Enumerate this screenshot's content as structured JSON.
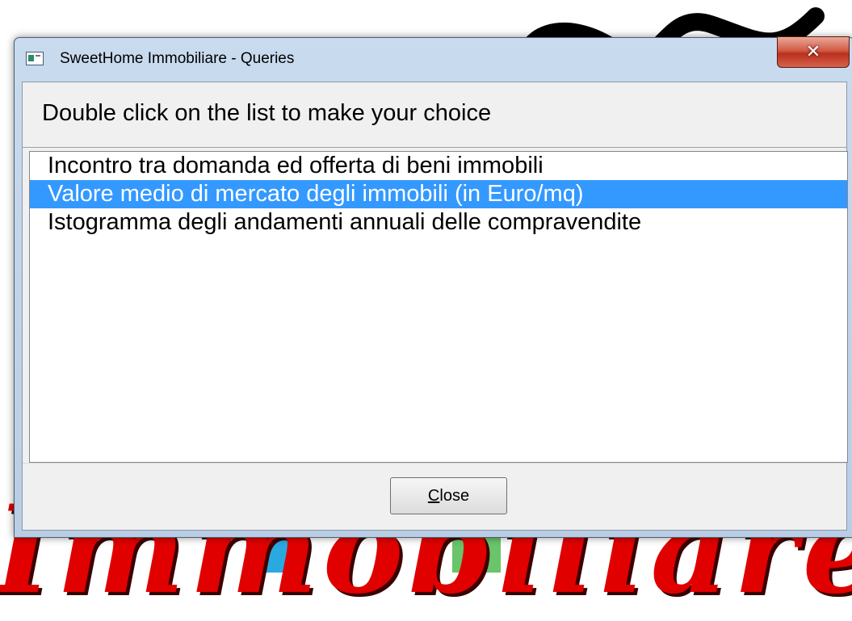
{
  "window": {
    "title": "SweetHome Immobiliare - Queries",
    "close_glyph": "✕"
  },
  "instruction": "Double click on the list to make your choice",
  "list": {
    "items": [
      "Incontro tra domanda ed offerta di beni immobili",
      "Valore medio di mercato degli immobili (in Euro/mq)",
      "Istogramma degli andamenti annuali delle compravendite"
    ],
    "selected_index": 1
  },
  "buttons": {
    "close_mnemonic": "C",
    "close_rest": "lose"
  },
  "background": {
    "text": "Immobiliare",
    "accent_color": "#e00000"
  },
  "colors": {
    "selection": "#3399ff",
    "title_close": "#c8432b"
  }
}
